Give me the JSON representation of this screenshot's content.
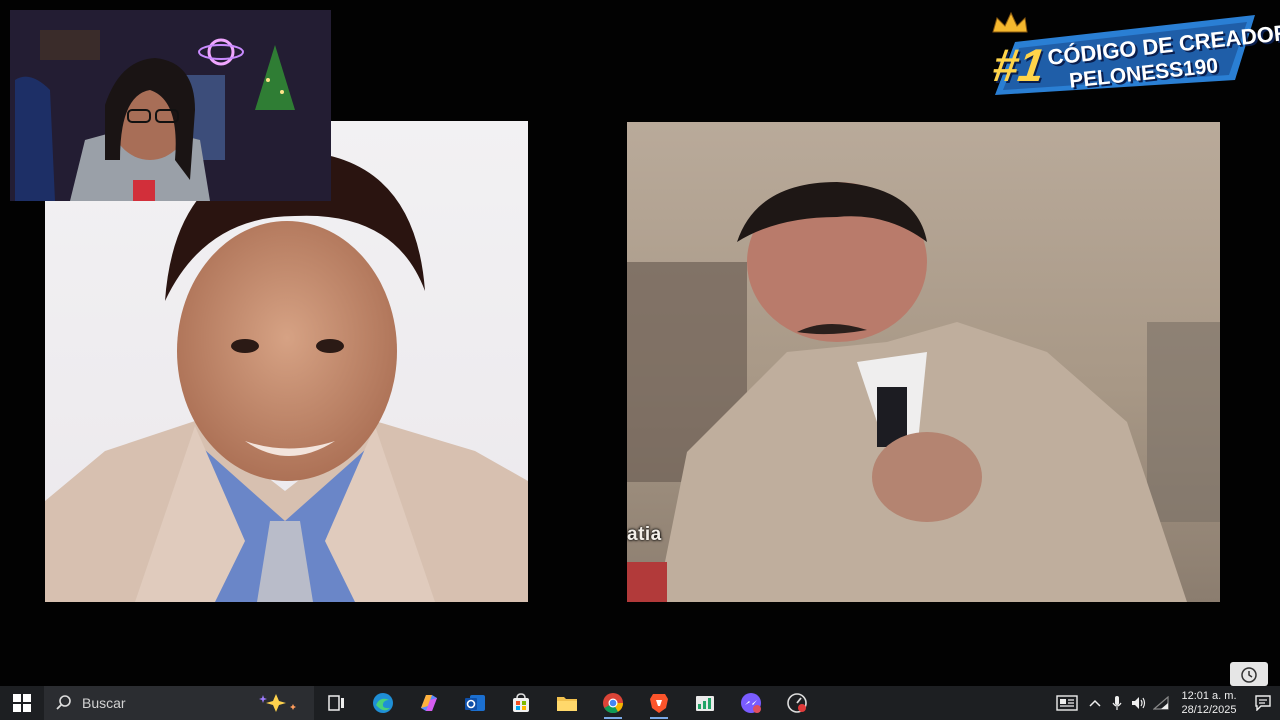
{
  "stream": {
    "overlay_caption": "atia"
  },
  "creator_banner": {
    "rank": "#1",
    "line1": "CÓDIGO DE CREADOR:",
    "line2": "PELONESS190"
  },
  "taskbar": {
    "search_placeholder": "Buscar",
    "icons": [
      "task-view",
      "edge",
      "copilot",
      "outlook",
      "microsoft-store",
      "file-explorer",
      "chrome",
      "brave",
      "spreadsheet-app",
      "messenger",
      "speedometer-app"
    ],
    "tray": {
      "time": "12:01 a. m.",
      "date": "28/12/2025"
    }
  },
  "colors": {
    "taskbar": "#1d1f22",
    "banner_blue": "#2a7fd4",
    "banner_gold": "#ffd44a"
  }
}
